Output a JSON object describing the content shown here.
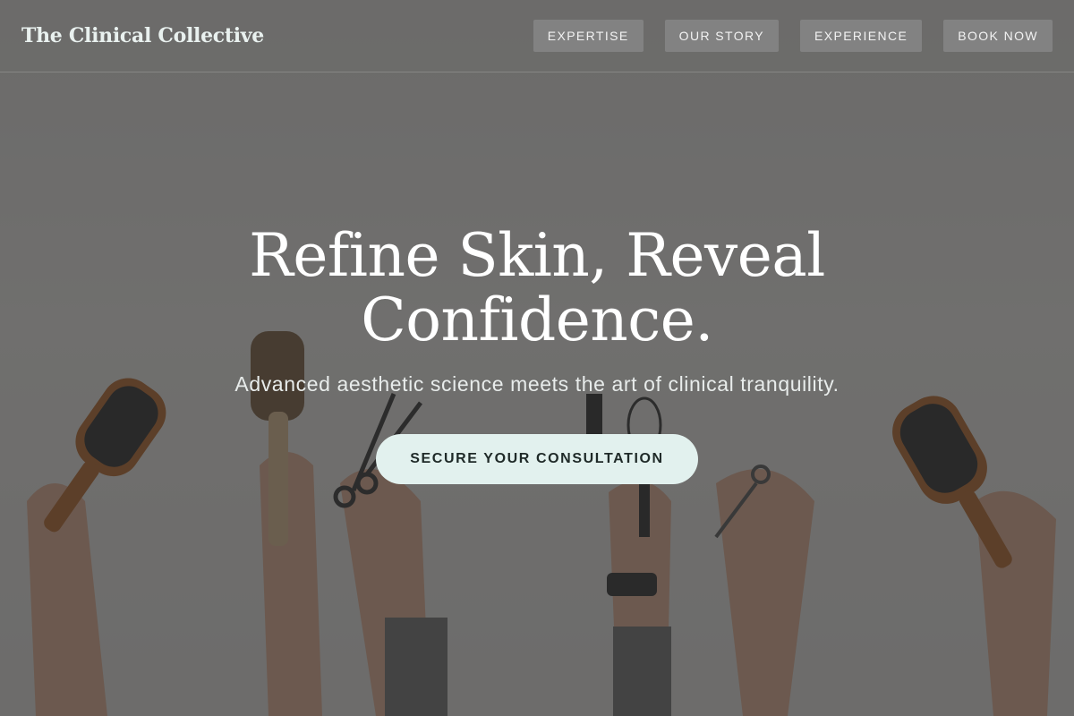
{
  "header": {
    "brand": "The Clinical Collective",
    "nav": [
      {
        "label": "EXPERTISE"
      },
      {
        "label": "OUR STORY"
      },
      {
        "label": "EXPERIENCE"
      },
      {
        "label": "BOOK NOW"
      }
    ]
  },
  "hero": {
    "title_line1": "Refine Skin, Reveal",
    "title_line2": "Confidence.",
    "subtitle": "Advanced aesthetic science meets the art of clinical tranquility.",
    "cta_label": "SECURE YOUR CONSULTATION"
  },
  "colors": {
    "overlay": "#3a3a3a",
    "cta_bg": "#e2f1ee",
    "brand_text": "#e9f1ef",
    "nav_bg": "#8c8c8c"
  },
  "background": {
    "description_icon": "hands-holding-hair-tools-photo"
  }
}
